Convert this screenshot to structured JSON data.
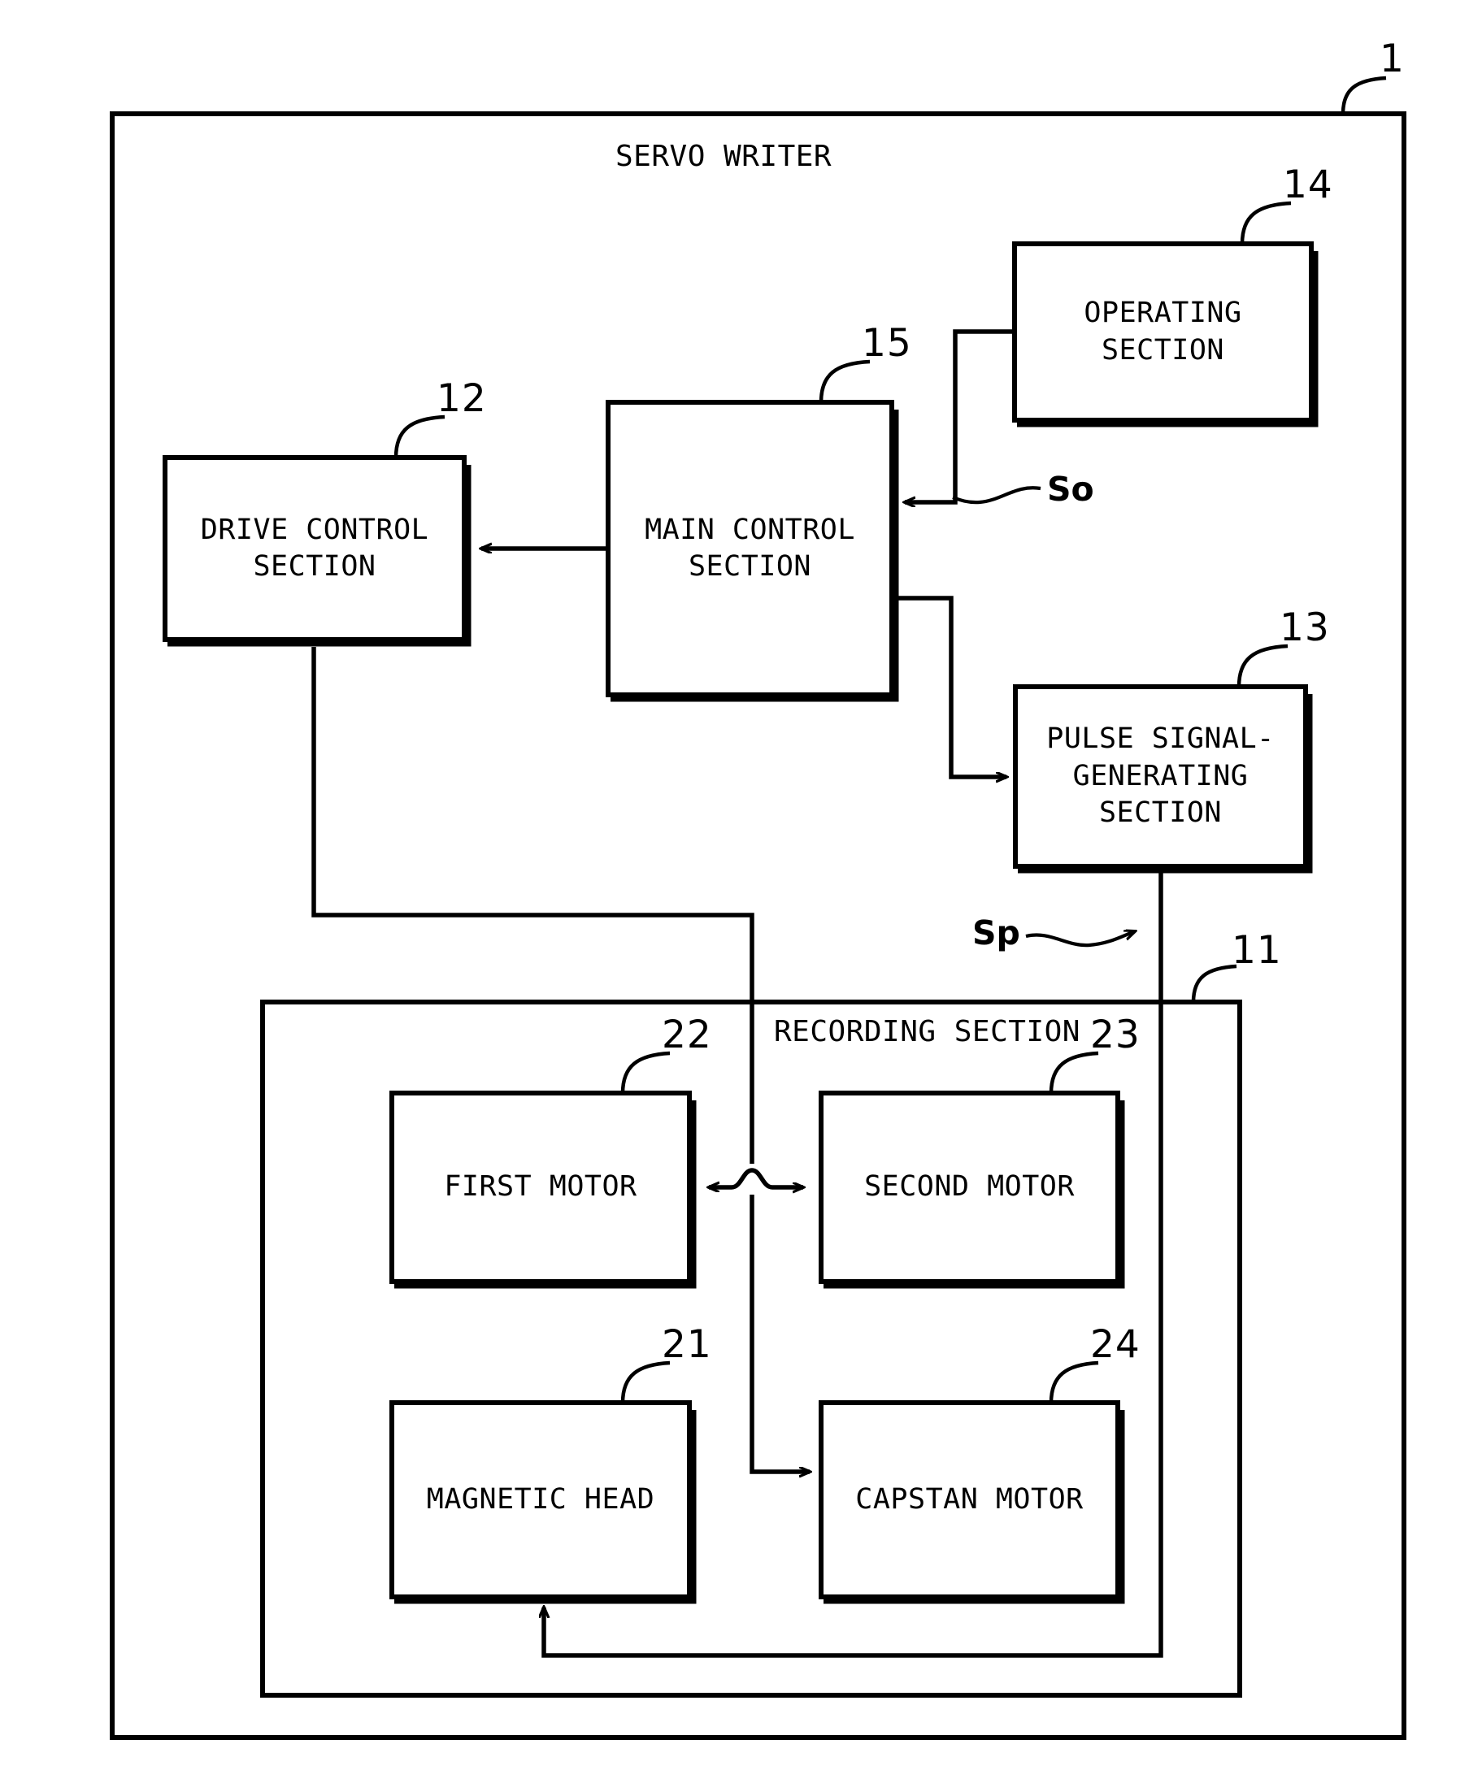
{
  "figure": {
    "title": "SERVO WRITER",
    "outer_ref": "1",
    "recording_section_title": "RECORDING SECTION",
    "recording_section_ref": "11"
  },
  "blocks": [
    {
      "id": "drive_control",
      "label": "DRIVE CONTROL\nSECTION",
      "ref": "12"
    },
    {
      "id": "main_control",
      "label": "MAIN CONTROL\nSECTION",
      "ref": "15"
    },
    {
      "id": "operating",
      "label": "OPERATING\nSECTION",
      "ref": "14"
    },
    {
      "id": "pulse_gen",
      "label": "PULSE SIGNAL-\nGENERATING\nSECTION",
      "ref": "13"
    },
    {
      "id": "first_motor",
      "label": "FIRST MOTOR",
      "ref": "22"
    },
    {
      "id": "second_motor",
      "label": "SECOND MOTOR",
      "ref": "23"
    },
    {
      "id": "magnetic_head",
      "label": "MAGNETIC HEAD",
      "ref": "21"
    },
    {
      "id": "capstan_motor",
      "label": "CAPSTAN MOTOR",
      "ref": "24"
    }
  ],
  "signals": [
    {
      "id": "so",
      "label": "So"
    },
    {
      "id": "sp",
      "label": "Sp"
    }
  ],
  "colors": {
    "line": "#000000",
    "background": "#ffffff",
    "fill": "#ffffff"
  }
}
